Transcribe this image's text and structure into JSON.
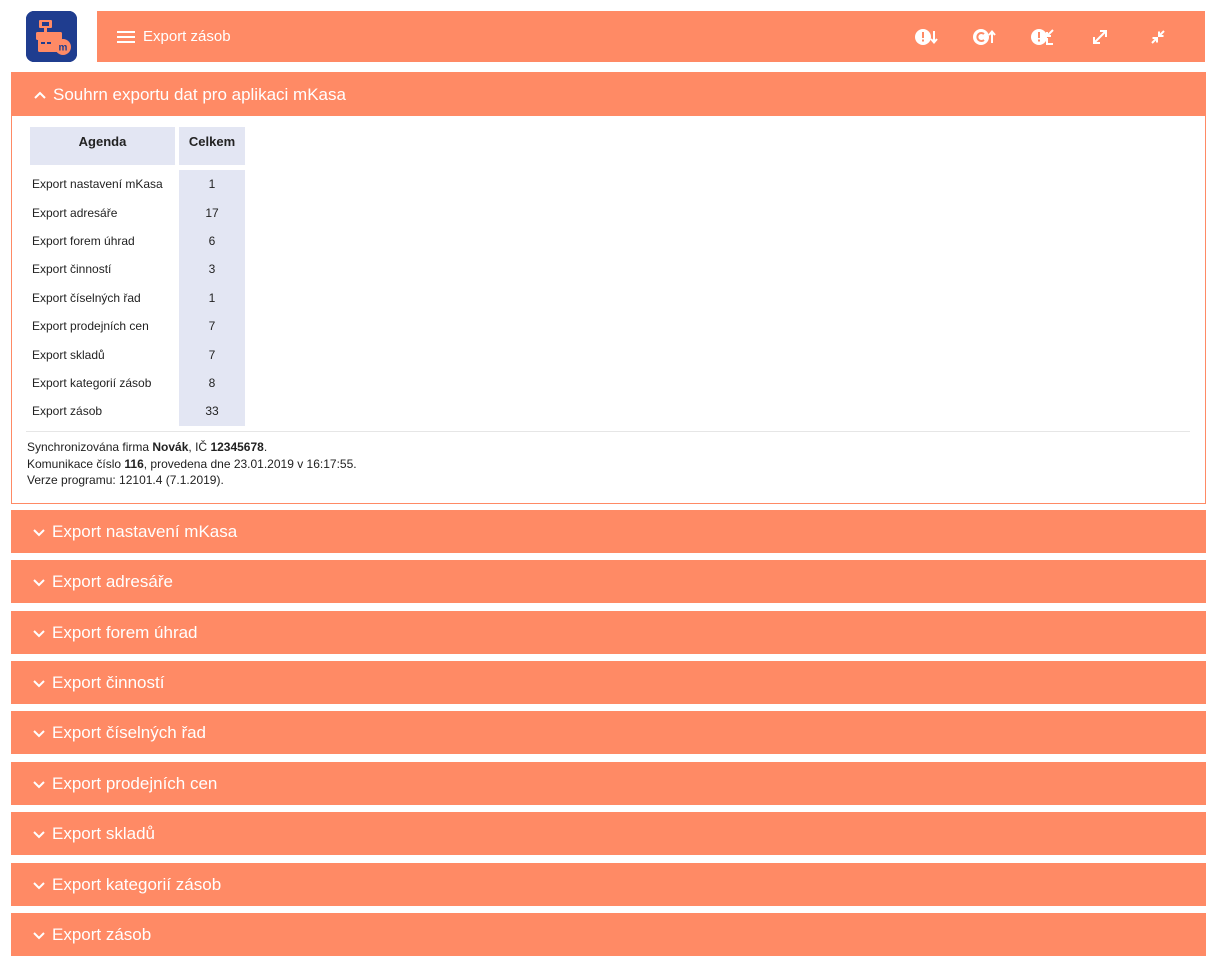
{
  "header": {
    "title": "Export zásob",
    "logo_icon": "mkasa-register-icon",
    "menu_icon": "hamburger-menu-icon",
    "actions": [
      {
        "name": "import-alert-button",
        "icon": "alert-down-arrow-icon"
      },
      {
        "name": "sync-upload-button",
        "icon": "sync-up-arrow-icon"
      },
      {
        "name": "alert-collapse-button",
        "icon": "alert-collapse-icon"
      },
      {
        "name": "expand-all-button",
        "icon": "expand-icon"
      },
      {
        "name": "collapse-all-button",
        "icon": "collapse-icon"
      }
    ]
  },
  "summary": {
    "title": "Souhrn exportu dat pro aplikaci mKasa",
    "columns": [
      "Agenda",
      "Celkem"
    ],
    "rows": [
      {
        "agenda": "Export nastavení mKasa",
        "total": "1"
      },
      {
        "agenda": "Export adresáře",
        "total": "17"
      },
      {
        "agenda": "Export forem úhrad",
        "total": "6"
      },
      {
        "agenda": "Export činností",
        "total": "3"
      },
      {
        "agenda": "Export číselných řad",
        "total": "1"
      },
      {
        "agenda": "Export prodejních cen",
        "total": "7"
      },
      {
        "agenda": "Export skladů",
        "total": "7"
      },
      {
        "agenda": "Export kategorií zásob",
        "total": "8"
      },
      {
        "agenda": "Export zásob",
        "total": "33"
      }
    ],
    "info": {
      "line1_prefix": "Synchronizována firma ",
      "company": "Novák",
      "line1_mid": ", IČ ",
      "ico": "12345678",
      "line1_suffix": ".",
      "line2_prefix": "Komunikace číslo ",
      "comm_number": "116",
      "line2_suffix": ", provedena dne 23.01.2019 v 16:17:55.",
      "line3": "Verze programu: 12101.4 (7.1.2019)."
    }
  },
  "sections": [
    "Export nastavení mKasa",
    "Export adresáře",
    "Export forem úhrad",
    "Export činností",
    "Export číselných řad",
    "Export prodejních cen",
    "Export skladů",
    "Export kategorií zásob",
    "Export zásob"
  ],
  "colors": {
    "accent": "#ff8a65",
    "logo_bg": "#1f3d8f",
    "table_header_bg": "#e3e6f3"
  }
}
